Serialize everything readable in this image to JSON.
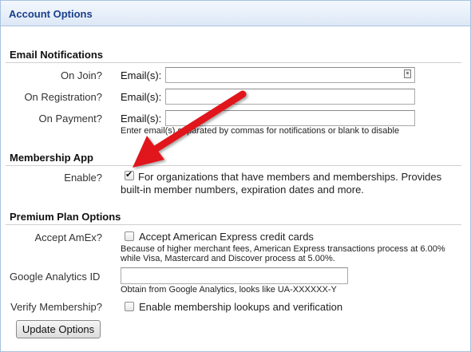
{
  "header": {
    "title": "Account Options"
  },
  "email_notifications": {
    "title": "Email Notifications",
    "rows": [
      {
        "label": "On Join?",
        "field_label": "Email(s):",
        "value": ""
      },
      {
        "label": "On Registration?",
        "field_label": "Email(s):",
        "value": ""
      },
      {
        "label": "On Payment?",
        "field_label": "Email(s):",
        "value": ""
      }
    ],
    "hint": "Enter email(s) separated by commas for notifications or blank to disable"
  },
  "membership_app": {
    "title": "Membership App",
    "enable_label": "Enable?",
    "checked": true,
    "description_line1": "For organizations that have members and memberships. Provides",
    "description_line2": "built-in member numbers, expiration dates and more."
  },
  "premium_plan": {
    "title": "Premium Plan Options",
    "amex": {
      "label": "Accept AmEx?",
      "checkbox_text": "Accept American Express credit cards",
      "checked": false,
      "hint_line1": "Because of higher merchant fees, American Express transactions process at 6.00%",
      "hint_line2": "while Visa, Mastercard and Discover process at 5.00%."
    },
    "analytics": {
      "label": "Google Analytics ID",
      "value": "",
      "hint": "Obtain from Google Analytics, looks like UA-XXXXXX-Y"
    },
    "verify": {
      "label": "Verify Membership?",
      "checkbox_text": "Enable membership lookups and verification",
      "checked": false
    }
  },
  "update_button": {
    "label": "Update Options"
  },
  "colors": {
    "header_text": "#1b3f8b",
    "header_border": "#a8c1e0",
    "arrow": "#e0191b"
  }
}
